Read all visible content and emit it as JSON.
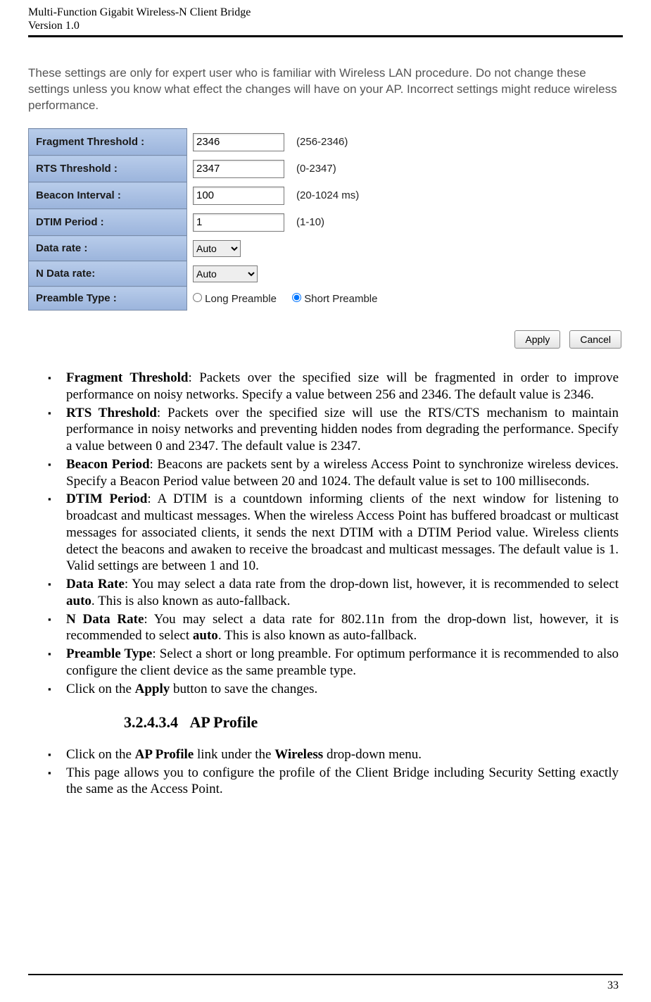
{
  "header": {
    "title1": "Multi-Function Gigabit Wireless-N Client Bridge",
    "title2": "Version 1.0"
  },
  "screenshot": {
    "warning": "These settings are only for expert user who is familiar with Wireless LAN procedure. Do not change these settings unless you know what effect the changes will have on your AP. Incorrect settings might reduce wireless performance.",
    "rows": {
      "fragment": {
        "label": "Fragment Threshold :",
        "value": "2346",
        "hint": "(256-2346)"
      },
      "rts": {
        "label": "RTS Threshold :",
        "value": "2347",
        "hint": "(0-2347)"
      },
      "beacon": {
        "label": "Beacon Interval :",
        "value": "100",
        "hint": "(20-1024 ms)"
      },
      "dtim": {
        "label": "DTIM Period :",
        "value": "1",
        "hint": "(1-10)"
      },
      "datarate": {
        "label": "Data rate :",
        "value": "Auto"
      },
      "ndatarate": {
        "label": "N Data rate:",
        "value": "Auto"
      },
      "preamble": {
        "label": "Preamble Type :",
        "opt1": "Long Preamble",
        "opt2": "Short Preamble"
      }
    },
    "buttons": {
      "apply": "Apply",
      "cancel": "Cancel"
    }
  },
  "bullets": {
    "b1_bold": "Fragment Threshold",
    "b1_text": ": Packets over the specified size will be fragmented in order to improve performance on noisy networks. Specify a value between 256 and 2346. The default value is 2346.",
    "b2_bold": "RTS Threshold",
    "b2_text": ": Packets over the specified size will use the RTS/CTS mechanism to maintain performance in noisy networks and preventing hidden nodes from degrading the performance. Specify a value between 0 and 2347. The default value is 2347.",
    "b3_bold": "Beacon Period",
    "b3_text": ": Beacons are packets sent by a wireless Access Point to synchronize wireless devices. Specify a Beacon Period value between 20 and 1024. The default value is set to 100 milliseconds.",
    "b4_bold": "DTIM Period",
    "b4_text": ": A DTIM is a countdown informing clients of the next window for listening to broadcast and multicast messages. When the wireless Access Point has buffered broadcast or multicast messages for associated clients, it sends the next DTIM with a DTIM Period value. Wireless clients detect the beacons and awaken to receive the broadcast and multicast messages. The default value is 1. Valid settings are between 1 and 10.",
    "b5_bold": "Data Rate",
    "b5_t1": ": You may select a data rate from the drop-down list, however, it is recommended to select ",
    "b5_auto": "auto",
    "b5_t2": ". This is also known as auto-fallback.",
    "b6_bold": "N Data Rate",
    "b6_t1": ": You may select a data rate for 802.11n from the drop-down list, however, it is recommended to select ",
    "b6_auto": "auto",
    "b6_t2": ". This is also known as auto-fallback.",
    "b7_bold": "Preamble Type",
    "b7_text": ": Select a short or long preamble. For optimum performance it is recommended to also configure the client device as the same preamble type.",
    "b8_t1": "Click on the ",
    "b8_bold": "Apply",
    "b8_t2": " button to save the changes."
  },
  "section": {
    "num": "3.2.4.3.4",
    "title": "AP Profile"
  },
  "bullets2": {
    "b1_t1": "Click on the ",
    "b1_b1": "AP Profile",
    "b1_t2": " link under the ",
    "b1_b2": "Wireless",
    "b1_t3": " drop-down menu.",
    "b2": "This page allows you to configure the profile of the Client Bridge including Security Setting exactly the same as the Access Point."
  },
  "page": "33"
}
